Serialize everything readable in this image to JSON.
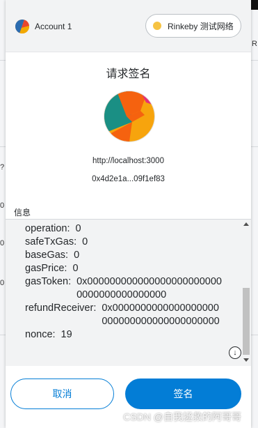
{
  "header": {
    "account_name": "Account 1",
    "network_label": "Rinkeby 测试网络"
  },
  "title": "请求签名",
  "origin": "http://localhost:3000",
  "address": "0x4d2e1a...09f1ef83",
  "message": {
    "label": "信息",
    "fields": [
      {
        "key": "operation:",
        "value": "0"
      },
      {
        "key": "safeTxGas:",
        "value": "0"
      },
      {
        "key": "baseGas:",
        "value": "0"
      },
      {
        "key": "gasPrice:",
        "value": "0"
      },
      {
        "key": "gasToken:",
        "value": "0x0000000000000000000000000000000000000000"
      },
      {
        "key": "refundReceiver:",
        "value": "0x0000000000000000000000000000000000000000"
      },
      {
        "key": "nonce:",
        "value": "19"
      }
    ]
  },
  "buttons": {
    "cancel": "取消",
    "sign": "签名"
  },
  "watermark": "CSDN @自我拯救的阿哥哥",
  "background": {
    "edge_right": "R",
    "edge_left_1": "?",
    "edge_left_2": "0",
    "edge_left_3": "0",
    "edge_left_4": "0"
  },
  "colors": {
    "primary": "#037dd6",
    "network_dot": "#f6c343",
    "panel_bg": "#f2f3f4"
  }
}
